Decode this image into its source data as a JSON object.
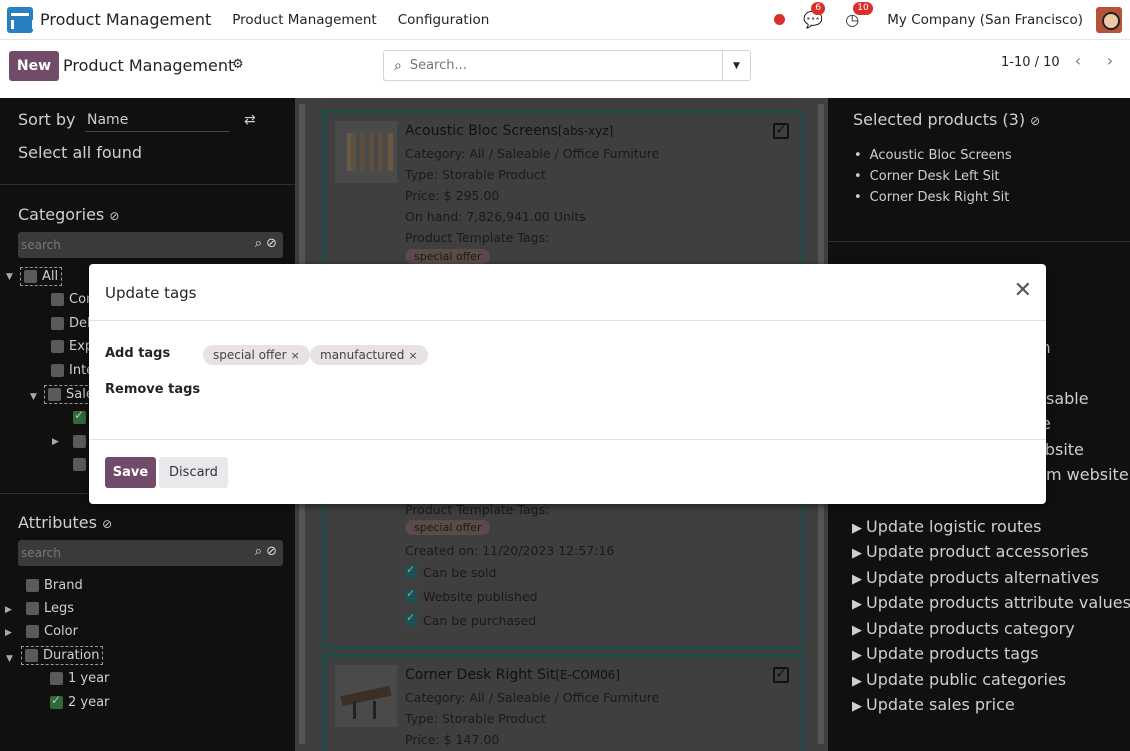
{
  "navbar": {
    "brand": "Product Management",
    "menus": [
      "Product Management",
      "Configuration"
    ],
    "messages_count": "6",
    "activities_count": "10",
    "company": "My Company (San Francisco)"
  },
  "control_panel": {
    "new_label": "New",
    "title": "Product Management",
    "search_placeholder": "Search...",
    "pager": "1-10 / 10"
  },
  "left_panel": {
    "sort_label": "Sort by",
    "sort_value": "Name",
    "select_all": "Select all found",
    "categories_heading": "Categories",
    "categories_search_placeholder": "search",
    "categories": [
      {
        "label": "All",
        "checked": false
      },
      {
        "label": "Con",
        "checked": false
      },
      {
        "label": "Del",
        "checked": false
      },
      {
        "label": "Exp",
        "checked": false
      },
      {
        "label": "Inte",
        "checked": false
      },
      {
        "label": "Sale",
        "checked": false
      }
    ],
    "attributes_heading": "Attributes",
    "attributes_search_placeholder": "search",
    "attributes": [
      {
        "label": "Brand",
        "checked": false
      },
      {
        "label": "Legs",
        "checked": false
      },
      {
        "label": "Color",
        "checked": false
      },
      {
        "label": "Duration",
        "checked": false
      },
      {
        "label": "1 year",
        "checked": false
      },
      {
        "label": "2 year",
        "checked": true
      }
    ]
  },
  "products": [
    {
      "name": "Acoustic Bloc Screens",
      "code": "[abs-xyz]",
      "category": "Category: All / Saleable / Office Furniture",
      "type": "Type: Storable Product",
      "price": "Price: $ 295.00",
      "on_hand": "On hand: 7,826,941.00 Units",
      "tags_label": "Product Template Tags:",
      "tag": "special offer"
    },
    {
      "tags_label": "Product Template Tags:",
      "tag": "special offer",
      "created": "Created on: 11/20/2023 12:57:16",
      "can_be_sold": "Can be sold",
      "website_published": "Website published",
      "can_be_purchased": "Can be purchased"
    },
    {
      "name": "Corner Desk Right Sit",
      "code": "[E-COM06]",
      "category": "Category: All / Saleable / Office Furniture",
      "type": "Type: Storable Product",
      "price": "Price: $ 147.00"
    }
  ],
  "right_panel": {
    "selected_heading": "Selected products (3)",
    "selected_items": [
      "Acoustic Bloc Screens",
      "Corner Desk Left Sit",
      "Corner Desk Right Sit"
    ],
    "partial_fragments": [
      "tion",
      "sable",
      "e",
      "ebsite",
      "m website"
    ],
    "actions": [
      "Update logistic routes",
      "Update product accessories",
      "Update products alternatives",
      "Update products attribute values",
      "Update products category",
      "Update products tags",
      "Update public categories",
      "Update sales price"
    ]
  },
  "modal": {
    "title": "Update tags",
    "add_tags_label": "Add tags",
    "remove_tags_label": "Remove tags",
    "add_tags": [
      "special offer",
      "manufactured"
    ],
    "save_label": "Save",
    "discard_label": "Discard"
  },
  "colors": {
    "primary": "#714b67",
    "badge": "#d9302c"
  }
}
